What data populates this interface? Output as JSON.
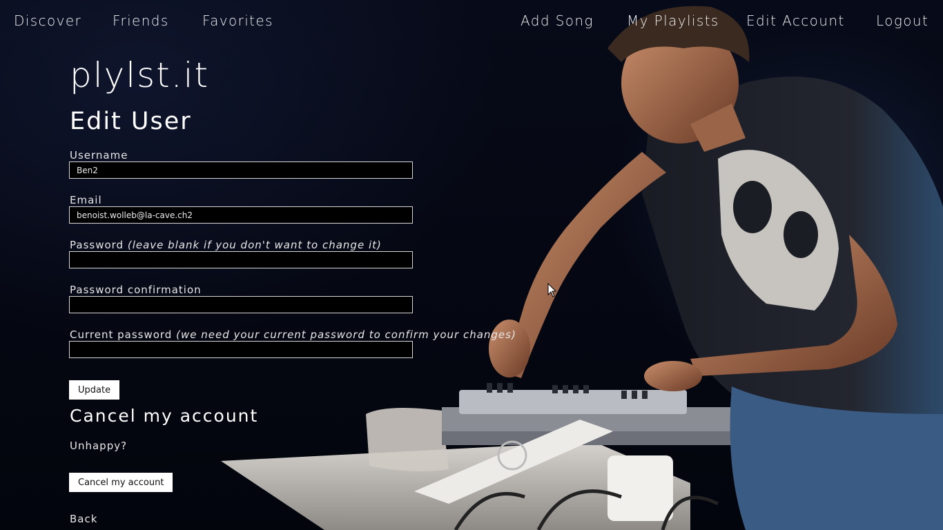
{
  "nav": {
    "left": [
      "Discover",
      "Friends",
      "Favorites"
    ],
    "right": [
      "Add Song",
      "My Playlists",
      "Edit Account",
      "Logout"
    ]
  },
  "brand": "plylst.it",
  "heading": "Edit User",
  "form": {
    "username": {
      "label": "Username",
      "value": "Ben2"
    },
    "email": {
      "label": "Email",
      "value": "benoist.wolleb@la-cave.ch2"
    },
    "password": {
      "label": "Password",
      "hint": "(leave blank if you don't want to change it)",
      "value": ""
    },
    "password_confirmation": {
      "label": "Password confirmation",
      "value": ""
    },
    "current_password": {
      "label": "Current password",
      "hint": "(we need your current password to confirm your changes)",
      "value": ""
    },
    "update_label": "Update"
  },
  "cancel": {
    "heading": "Cancel my account",
    "text": "Unhappy?",
    "button_label": "Cancel my account"
  },
  "back_label": "Back",
  "colors": {
    "background": "#050814",
    "text": "#ffffff",
    "button_bg": "#ffffff",
    "button_text": "#111111"
  }
}
